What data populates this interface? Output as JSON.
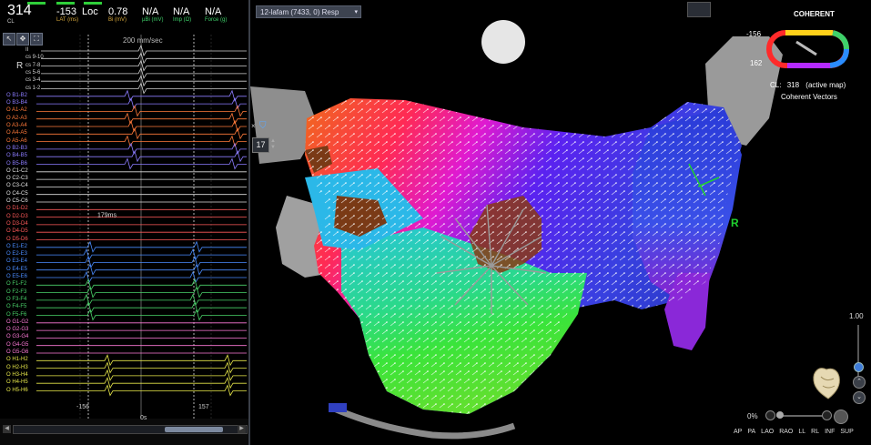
{
  "stats": [
    {
      "value": "314",
      "label": "CL",
      "label_color": "#cfcfcf"
    },
    {
      "value": "-153",
      "label": "LAT (ms)",
      "label_color": "#d9a93a"
    },
    {
      "value": "Loc",
      "label": "",
      "label_color": "#cfcfcf"
    },
    {
      "value": "0.78",
      "label": "Bi (mV)",
      "label_color": "#d9a93a"
    },
    {
      "value": "N/A",
      "label": "µBi (mV)",
      "label_color": "#3ed16a"
    },
    {
      "value": "N/A",
      "label": "Imp (Ω)",
      "label_color": "#3ed16a"
    },
    {
      "value": "N/A",
      "label": "Force (g)",
      "label_color": "#3ed16a"
    }
  ],
  "egm": {
    "speed_label": "200 mm/sec",
    "r_label": "R",
    "interval_label": "179ms",
    "cursor_left": "-156",
    "cursor_right": "157",
    "bottom_center": "0s",
    "channels": [
      {
        "label": "II",
        "color": "#d0d0d0"
      },
      {
        "label": "cs 9-10",
        "color": "#d0d0d0"
      },
      {
        "label": "cs 7-8",
        "color": "#d0d0d0"
      },
      {
        "label": "cs 5-6",
        "color": "#d0d0d0"
      },
      {
        "label": "cs 3-4",
        "color": "#d0d0d0"
      },
      {
        "label": "cs 1-2",
        "color": "#d0d0d0"
      },
      {
        "label": "O B1-B2",
        "color": "#8c7cff"
      },
      {
        "label": "O B3-B4",
        "color": "#8c7cff"
      },
      {
        "label": "O A1-A2",
        "color": "#ff7a3a"
      },
      {
        "label": "O A2-A3",
        "color": "#ff7a3a"
      },
      {
        "label": "O A3-A4",
        "color": "#ff7a3a"
      },
      {
        "label": "O A4-A5",
        "color": "#ff7a3a"
      },
      {
        "label": "O A5-A6",
        "color": "#ff7a3a"
      },
      {
        "label": "O B2-B3",
        "color": "#8c7cff"
      },
      {
        "label": "O B4-B5",
        "color": "#8c7cff"
      },
      {
        "label": "O B5-B6",
        "color": "#8c7cff"
      },
      {
        "label": "O C1-C2",
        "color": "#e0e0e0"
      },
      {
        "label": "O C2-C3",
        "color": "#e0e0e0"
      },
      {
        "label": "O C3-C4",
        "color": "#e0e0e0"
      },
      {
        "label": "O C4-C5",
        "color": "#e0e0e0"
      },
      {
        "label": "O C5-C6",
        "color": "#e0e0e0"
      },
      {
        "label": "O D1-D2",
        "color": "#ff5a5a"
      },
      {
        "label": "O D2-D3",
        "color": "#ff5a5a"
      },
      {
        "label": "O D3-D4",
        "color": "#ff5a5a"
      },
      {
        "label": "O D4-D5",
        "color": "#ff5a5a"
      },
      {
        "label": "O D5-D6",
        "color": "#ff5a5a"
      },
      {
        "label": "O E1-E2",
        "color": "#4a8cff"
      },
      {
        "label": "O E2-E3",
        "color": "#4a8cff"
      },
      {
        "label": "O E3-E4",
        "color": "#4a8cff"
      },
      {
        "label": "O E4-E5",
        "color": "#4a8cff"
      },
      {
        "label": "O E5-E6",
        "color": "#4a8cff"
      },
      {
        "label": "O F1-F2",
        "color": "#4ad36a"
      },
      {
        "label": "O F2-F3",
        "color": "#4ad36a"
      },
      {
        "label": "O F3-F4",
        "color": "#4ad36a"
      },
      {
        "label": "O F4-F5",
        "color": "#4ad36a"
      },
      {
        "label": "O F5-F6",
        "color": "#4ad36a"
      },
      {
        "label": "O G1-G2",
        "color": "#ff7ad9"
      },
      {
        "label": "O G2-G3",
        "color": "#ff7ad9"
      },
      {
        "label": "O G3-G4",
        "color": "#ff7ad9"
      },
      {
        "label": "O G4-G5",
        "color": "#ff7ad9"
      },
      {
        "label": "O G5-G6",
        "color": "#ff7ad9"
      },
      {
        "label": "O H1-H2",
        "color": "#e8e84a"
      },
      {
        "label": "O H2-H3",
        "color": "#e8e84a"
      },
      {
        "label": "O H3-H4",
        "color": "#e8e84a"
      },
      {
        "label": "O H4-H5",
        "color": "#e8e84a"
      },
      {
        "label": "O H5-H6",
        "color": "#e8e84a"
      }
    ]
  },
  "map": {
    "dropdown_label": "12-lafam (7433, 0) Resp",
    "coherent_title": "COHERENT",
    "ring_top_value": "-156",
    "ring_bottom_value": "162",
    "cl_prefix": "CL:",
    "cl_value": "318",
    "cl_suffix": "(active map)",
    "vectors_label": "Coherent Vectors",
    "point_count": "17",
    "r_marker": "R",
    "zoom_value": "1.00",
    "transparency_value": "0%",
    "view_buttons": [
      "AP",
      "PA",
      "LAO",
      "RAO",
      "LL",
      "RL",
      "INF",
      "SUP"
    ]
  },
  "colors": {
    "panel_border": "#3a3f48",
    "accent_blue": "#3e7bd8",
    "green": "#2fcf3a"
  }
}
